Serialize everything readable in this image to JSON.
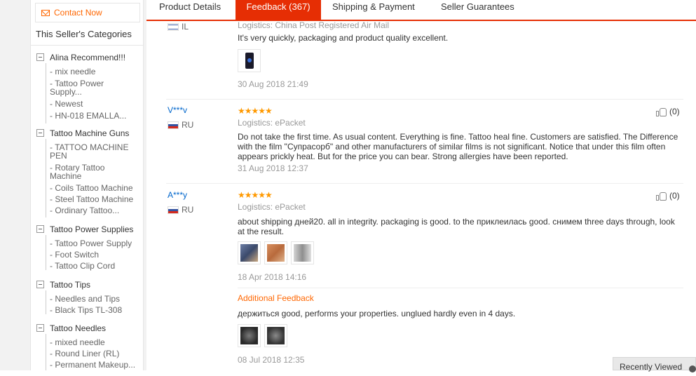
{
  "sidebar": {
    "contact_label": "Contact Now",
    "categories_title": "This Seller's Categories",
    "groups": [
      {
        "label": "Alina Recommend!!!",
        "items": [
          "- mix needle",
          "- Tattoo Power",
          "Supply...",
          "- Newest",
          "- HN-018 EMALLA..."
        ]
      },
      {
        "label": "Tattoo Machine Guns",
        "items": [
          "- TATTOO MACHINE",
          "PEN",
          "- Rotary Tattoo",
          "Machine",
          "- Coils Tattoo Machine",
          "- Steel Tattoo Machine",
          "- Ordinary Tattoo..."
        ]
      },
      {
        "label": "Tattoo Power Supplies",
        "items": [
          "- Tattoo Power Supply",
          "- Foot Switch",
          "- Tattoo Clip Cord"
        ]
      },
      {
        "label": "Tattoo Tips",
        "items": [
          "- Needles and Tips",
          "- Black Tips TL-308"
        ]
      },
      {
        "label": "Tattoo Needles",
        "items": [
          "- mixed needle",
          "- Round Liner (RL)",
          "- Permanent Makeup..."
        ]
      }
    ]
  },
  "tabs": [
    "Product Details",
    "Feedback (367)",
    "Shipping & Payment",
    "Seller Guarantees"
  ],
  "feedback": [
    {
      "country": "IL",
      "logistics": "Logistics: China Post Registered Air Mail",
      "text": "It's very quickly, packaging and product quality excellent.",
      "date": "30 Aug 2018 21:49"
    },
    {
      "user": "V***v",
      "country": "RU",
      "stars": "★★★★★",
      "logistics": "Logistics: ePacket",
      "text": "Do not take the first time. As usual content. Everything is fine. Tattoo heal fine. Customers are satisfied. The Difference with the film \"Супрасорб\" and other manufacturers of similar films is not significant. Notice that under this film often appears prickly heat. But for the price you can bear. Strong allergies have been reported.",
      "date": "31 Aug 2018 12:37",
      "helpful": "(0)"
    },
    {
      "user": "A***y",
      "country": "RU",
      "stars": "★★★★★",
      "logistics": "Logistics: ePacket",
      "text": "about shipping дней20. all in integrity. packaging is good. to the приклеилась good. снимем three days through, look at the result.",
      "date": "18 Apr 2018 14:16",
      "helpful": "(0)",
      "additional_label": "Additional Feedback",
      "additional_text": "держиться good, performs your properties. unglued hardly even in 4 days.",
      "additional_date": "08 Jul 2018 12:35"
    }
  ],
  "recently_viewed": "Recently Viewed",
  "colors": {
    "accent": "#e62e04",
    "orange": "#ff6600",
    "stars": "#ff9900",
    "link": "#0066cc"
  }
}
